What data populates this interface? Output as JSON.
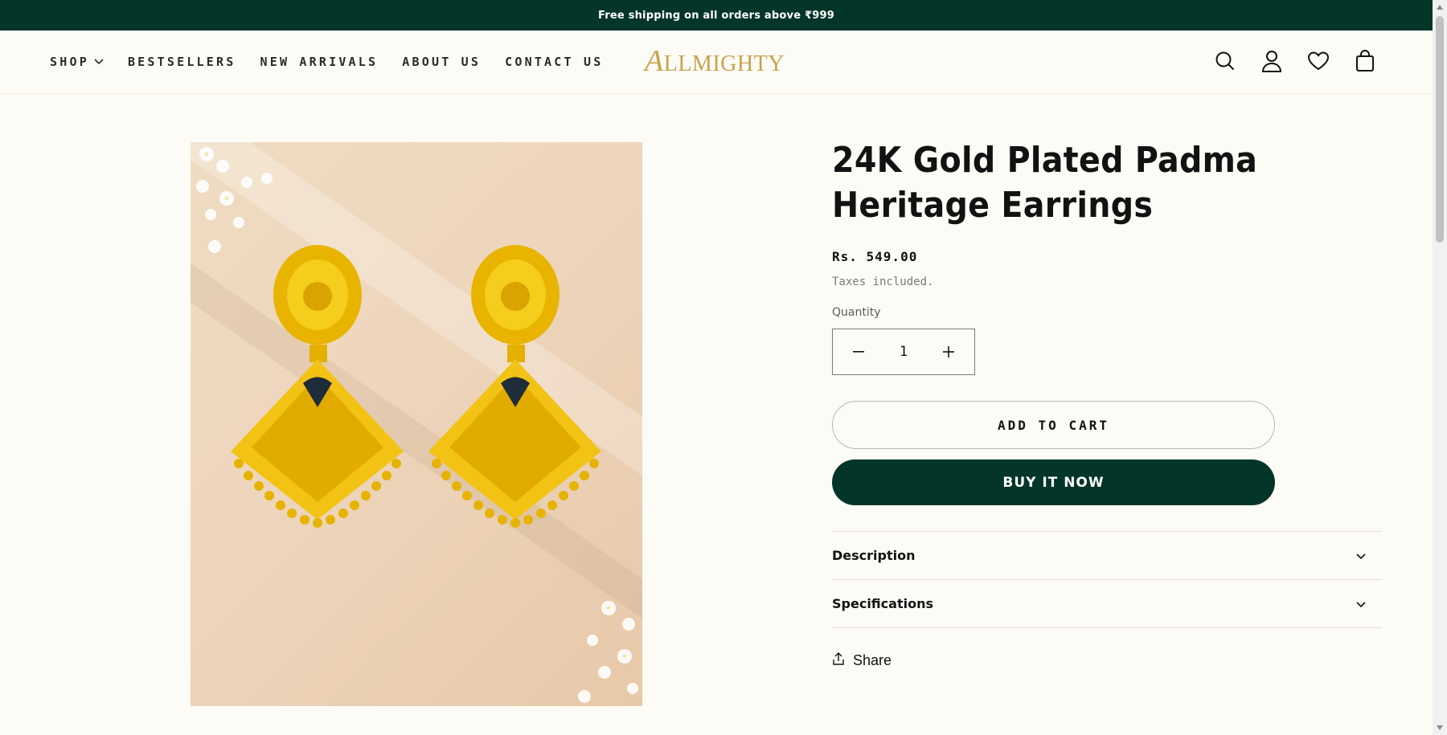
{
  "announcement": {
    "text": "Free shipping on all orders above ₹999"
  },
  "nav": {
    "items": [
      {
        "label": "SHOP",
        "has_dropdown": true
      },
      {
        "label": "BESTSELLERS"
      },
      {
        "label": "NEW ARRIVALS"
      },
      {
        "label": "ABOUT US"
      },
      {
        "label": "CONTACT US"
      }
    ]
  },
  "logo": {
    "first_letter": "A",
    "rest": "LLMIGHTY",
    "color": "#c9a24a"
  },
  "header_icons": [
    "search-icon",
    "account-icon",
    "wishlist-heart-icon",
    "cart-bag-icon"
  ],
  "product": {
    "title": "24K Gold Plated Padma Heritage Earrings",
    "price": "Rs. 549.00",
    "tax_note": "Taxes included.",
    "quantity_label": "Quantity",
    "quantity_value": "1",
    "add_to_cart_label": "ADD TO CART",
    "buy_now_label": "BUY IT NOW",
    "accordion": [
      {
        "label": "Description"
      },
      {
        "label": "Specifications"
      }
    ],
    "share_label": "Share"
  },
  "colors": {
    "brand_dark_green": "#033628",
    "background": "#fdfbf6",
    "gold": "#c9a24a"
  }
}
